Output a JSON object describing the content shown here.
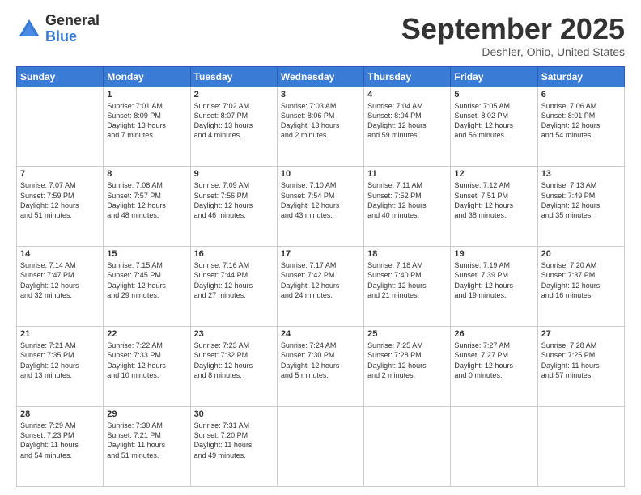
{
  "header": {
    "logo_general": "General",
    "logo_blue": "Blue",
    "month_title": "September 2025",
    "location": "Deshler, Ohio, United States"
  },
  "days_of_week": [
    "Sunday",
    "Monday",
    "Tuesday",
    "Wednesday",
    "Thursday",
    "Friday",
    "Saturday"
  ],
  "weeks": [
    [
      {
        "day": "",
        "info": ""
      },
      {
        "day": "1",
        "info": "Sunrise: 7:01 AM\nSunset: 8:09 PM\nDaylight: 13 hours\nand 7 minutes."
      },
      {
        "day": "2",
        "info": "Sunrise: 7:02 AM\nSunset: 8:07 PM\nDaylight: 13 hours\nand 4 minutes."
      },
      {
        "day": "3",
        "info": "Sunrise: 7:03 AM\nSunset: 8:06 PM\nDaylight: 13 hours\nand 2 minutes."
      },
      {
        "day": "4",
        "info": "Sunrise: 7:04 AM\nSunset: 8:04 PM\nDaylight: 12 hours\nand 59 minutes."
      },
      {
        "day": "5",
        "info": "Sunrise: 7:05 AM\nSunset: 8:02 PM\nDaylight: 12 hours\nand 56 minutes."
      },
      {
        "day": "6",
        "info": "Sunrise: 7:06 AM\nSunset: 8:01 PM\nDaylight: 12 hours\nand 54 minutes."
      }
    ],
    [
      {
        "day": "7",
        "info": "Sunrise: 7:07 AM\nSunset: 7:59 PM\nDaylight: 12 hours\nand 51 minutes."
      },
      {
        "day": "8",
        "info": "Sunrise: 7:08 AM\nSunset: 7:57 PM\nDaylight: 12 hours\nand 48 minutes."
      },
      {
        "day": "9",
        "info": "Sunrise: 7:09 AM\nSunset: 7:56 PM\nDaylight: 12 hours\nand 46 minutes."
      },
      {
        "day": "10",
        "info": "Sunrise: 7:10 AM\nSunset: 7:54 PM\nDaylight: 12 hours\nand 43 minutes."
      },
      {
        "day": "11",
        "info": "Sunrise: 7:11 AM\nSunset: 7:52 PM\nDaylight: 12 hours\nand 40 minutes."
      },
      {
        "day": "12",
        "info": "Sunrise: 7:12 AM\nSunset: 7:51 PM\nDaylight: 12 hours\nand 38 minutes."
      },
      {
        "day": "13",
        "info": "Sunrise: 7:13 AM\nSunset: 7:49 PM\nDaylight: 12 hours\nand 35 minutes."
      }
    ],
    [
      {
        "day": "14",
        "info": "Sunrise: 7:14 AM\nSunset: 7:47 PM\nDaylight: 12 hours\nand 32 minutes."
      },
      {
        "day": "15",
        "info": "Sunrise: 7:15 AM\nSunset: 7:45 PM\nDaylight: 12 hours\nand 29 minutes."
      },
      {
        "day": "16",
        "info": "Sunrise: 7:16 AM\nSunset: 7:44 PM\nDaylight: 12 hours\nand 27 minutes."
      },
      {
        "day": "17",
        "info": "Sunrise: 7:17 AM\nSunset: 7:42 PM\nDaylight: 12 hours\nand 24 minutes."
      },
      {
        "day": "18",
        "info": "Sunrise: 7:18 AM\nSunset: 7:40 PM\nDaylight: 12 hours\nand 21 minutes."
      },
      {
        "day": "19",
        "info": "Sunrise: 7:19 AM\nSunset: 7:39 PM\nDaylight: 12 hours\nand 19 minutes."
      },
      {
        "day": "20",
        "info": "Sunrise: 7:20 AM\nSunset: 7:37 PM\nDaylight: 12 hours\nand 16 minutes."
      }
    ],
    [
      {
        "day": "21",
        "info": "Sunrise: 7:21 AM\nSunset: 7:35 PM\nDaylight: 12 hours\nand 13 minutes."
      },
      {
        "day": "22",
        "info": "Sunrise: 7:22 AM\nSunset: 7:33 PM\nDaylight: 12 hours\nand 10 minutes."
      },
      {
        "day": "23",
        "info": "Sunrise: 7:23 AM\nSunset: 7:32 PM\nDaylight: 12 hours\nand 8 minutes."
      },
      {
        "day": "24",
        "info": "Sunrise: 7:24 AM\nSunset: 7:30 PM\nDaylight: 12 hours\nand 5 minutes."
      },
      {
        "day": "25",
        "info": "Sunrise: 7:25 AM\nSunset: 7:28 PM\nDaylight: 12 hours\nand 2 minutes."
      },
      {
        "day": "26",
        "info": "Sunrise: 7:27 AM\nSunset: 7:27 PM\nDaylight: 12 hours\nand 0 minutes."
      },
      {
        "day": "27",
        "info": "Sunrise: 7:28 AM\nSunset: 7:25 PM\nDaylight: 11 hours\nand 57 minutes."
      }
    ],
    [
      {
        "day": "28",
        "info": "Sunrise: 7:29 AM\nSunset: 7:23 PM\nDaylight: 11 hours\nand 54 minutes."
      },
      {
        "day": "29",
        "info": "Sunrise: 7:30 AM\nSunset: 7:21 PM\nDaylight: 11 hours\nand 51 minutes."
      },
      {
        "day": "30",
        "info": "Sunrise: 7:31 AM\nSunset: 7:20 PM\nDaylight: 11 hours\nand 49 minutes."
      },
      {
        "day": "",
        "info": ""
      },
      {
        "day": "",
        "info": ""
      },
      {
        "day": "",
        "info": ""
      },
      {
        "day": "",
        "info": ""
      }
    ]
  ]
}
